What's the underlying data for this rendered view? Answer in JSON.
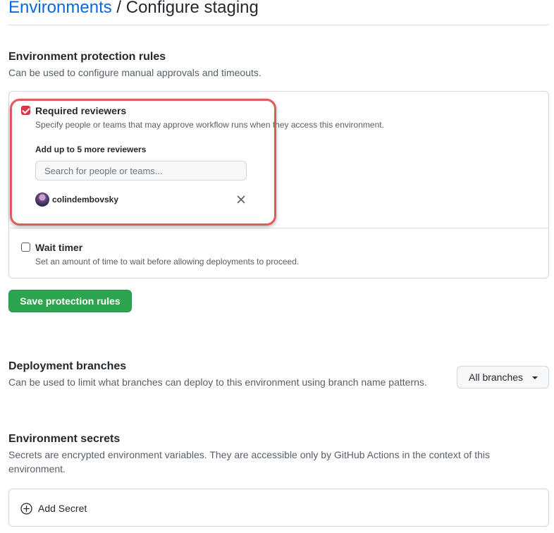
{
  "header": {
    "breadcrumb_link": "Environments",
    "separator": " / ",
    "page_title": "Configure staging"
  },
  "protection_rules": {
    "title": "Environment protection rules",
    "description": "Can be used to configure manual approvals and timeouts.",
    "required_reviewers": {
      "checked": true,
      "label": "Required reviewers",
      "description": "Specify people or teams that may approve workflow runs when they access this environment.",
      "add_label": "Add up to 5 more reviewers",
      "search_placeholder": "Search for people or teams...",
      "reviewers": [
        {
          "username": "colindembovsky"
        }
      ]
    },
    "wait_timer": {
      "checked": false,
      "label": "Wait timer",
      "description": "Set an amount of time to wait before allowing deployments to proceed."
    },
    "save_label": "Save protection rules"
  },
  "deployment_branches": {
    "title": "Deployment branches",
    "description": "Can be used to limit what branches can deploy to this environment using branch name patterns.",
    "selected": "All branches"
  },
  "environment_secrets": {
    "title": "Environment secrets",
    "description": "Secrets are encrypted environment variables. They are accessible only by GitHub Actions in the context of this environment.",
    "add_label": "Add Secret"
  },
  "colors": {
    "link": "#0969da",
    "primary_button": "#2da44e",
    "highlight": "#e25a57",
    "checkbox_checked": "#d73a49"
  }
}
